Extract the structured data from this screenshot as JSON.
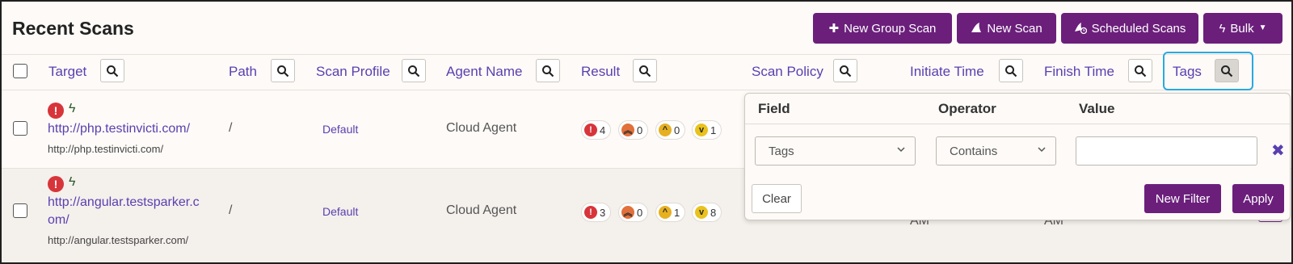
{
  "page": {
    "title": "Recent Scans"
  },
  "toolbar": {
    "new_group_scan": "New Group Scan",
    "new_scan": "New Scan",
    "scheduled_scans": "Scheduled Scans",
    "bulk": "Bulk"
  },
  "columns": [
    {
      "label": "Target"
    },
    {
      "label": "Path"
    },
    {
      "label": "Scan Profile"
    },
    {
      "label": "Agent Name"
    },
    {
      "label": "Result"
    },
    {
      "label": "Scan Policy"
    },
    {
      "label": "Initiate Time"
    },
    {
      "label": "Finish Time"
    },
    {
      "label": "Tags"
    }
  ],
  "rows": [
    {
      "target_link": "http://php.testinvicti.com/",
      "target_sub": "http://php.testinvicti.com/",
      "path": "/",
      "profile": "Default",
      "agent": "Cloud Agent",
      "result": {
        "critical": "4",
        "high": "0",
        "medium": "0",
        "low": "1"
      }
    },
    {
      "target_link_1": "http://angular.testsparker.c",
      "target_link_2": "om/",
      "target_sub": "http://angular.testsparker.com/",
      "path": "/",
      "profile": "Default",
      "agent": "Cloud Agent",
      "result": {
        "critical": "3",
        "high": "0",
        "medium": "1",
        "low": "8"
      },
      "initiate_partial": "AM",
      "finish_partial": "AM"
    }
  ],
  "filter": {
    "headers": {
      "field": "Field",
      "operator": "Operator",
      "value": "Value"
    },
    "field_selected": "Tags",
    "operator_selected": "Contains",
    "value": "",
    "clear": "Clear",
    "new_filter": "New Filter",
    "apply": "Apply"
  },
  "colors": {
    "accent": "#6b1f7b",
    "link": "#5a3fb0",
    "focus": "#2aa9e0",
    "critical": "#d7353a"
  }
}
